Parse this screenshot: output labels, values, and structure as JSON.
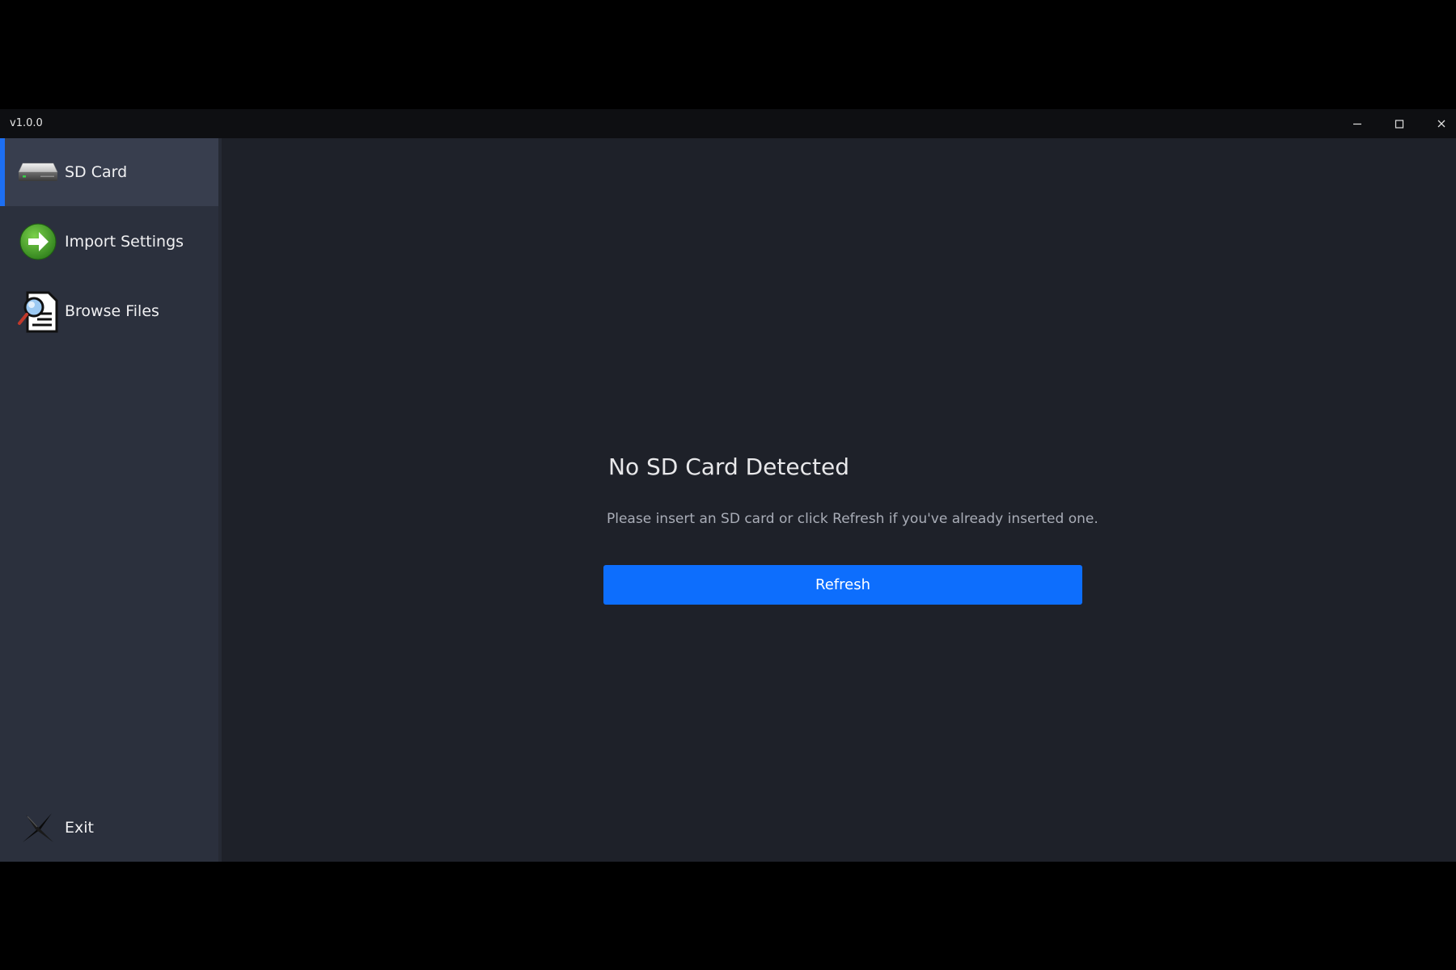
{
  "window": {
    "title": "v1.0.0"
  },
  "window_controls": {
    "minimize_icon": "minimize-icon",
    "maximize_icon": "maximize-icon",
    "close_icon": "close-icon"
  },
  "sidebar": {
    "items": [
      {
        "label": "SD Card",
        "icon": "sd-card-drive-icon",
        "active": true
      },
      {
        "label": "Import Settings",
        "icon": "green-arrow-icon",
        "active": false
      },
      {
        "label": "Browse Files",
        "icon": "document-search-icon",
        "active": false
      }
    ],
    "exit": {
      "label": "Exit",
      "icon": "exit-x-icon"
    }
  },
  "main": {
    "title": "No SD Card Detected",
    "description": "Please insert an SD card or click Refresh if you've already inserted one.",
    "refresh_label": "Refresh"
  },
  "colors": {
    "accent": "#0d6efd",
    "sidebar_bg": "#2b303d",
    "sidebar_active_bg": "#383e4e",
    "main_bg": "#1e2129",
    "titlebar_bg": "#0e0f12"
  }
}
